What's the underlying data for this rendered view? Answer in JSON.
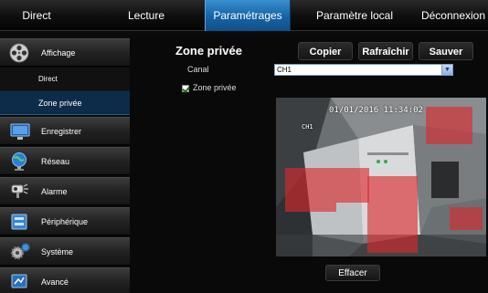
{
  "topnav": {
    "direct": "Direct",
    "lecture": "Lecture",
    "parametrages": "Paramétrages",
    "parametre_local": "Paramètre local",
    "deconnexion": "Déconnexion"
  },
  "sidebar": {
    "affichage": "Affichage",
    "sub_direct": "Direct",
    "sub_zone_privee": "Zone privée",
    "enregistrer": "Enregistrer",
    "reseau": "Réseau",
    "alarme": "Alarme",
    "peripherique": "Périphérique",
    "systeme": "Système",
    "avance": "Avancé"
  },
  "content": {
    "title": "Zone privée",
    "copier": "Copier",
    "rafraichir": "Rafraîchir",
    "sauver": "Sauver",
    "canal_label": "Canal",
    "canal_value": "CH1",
    "zone_privee_checkbox": "Zone privée",
    "zone_privee_checked": true,
    "osd_timestamp": "01/01/2016 11:34:02",
    "osd_channel": "CH1",
    "effacer": "Effacer"
  },
  "colors": {
    "accent": "#1766a8",
    "mask": "#dc282d"
  },
  "icons": {
    "affichage": "film-reel-icon",
    "enregistrer": "monitor-record-icon",
    "reseau": "globe-network-icon",
    "alarme": "alarm-camera-icon",
    "peripherique": "device-drive-icon",
    "systeme": "gears-icon",
    "avance": "advanced-monitor-icon",
    "dropdown": "chevron-down-icon"
  }
}
